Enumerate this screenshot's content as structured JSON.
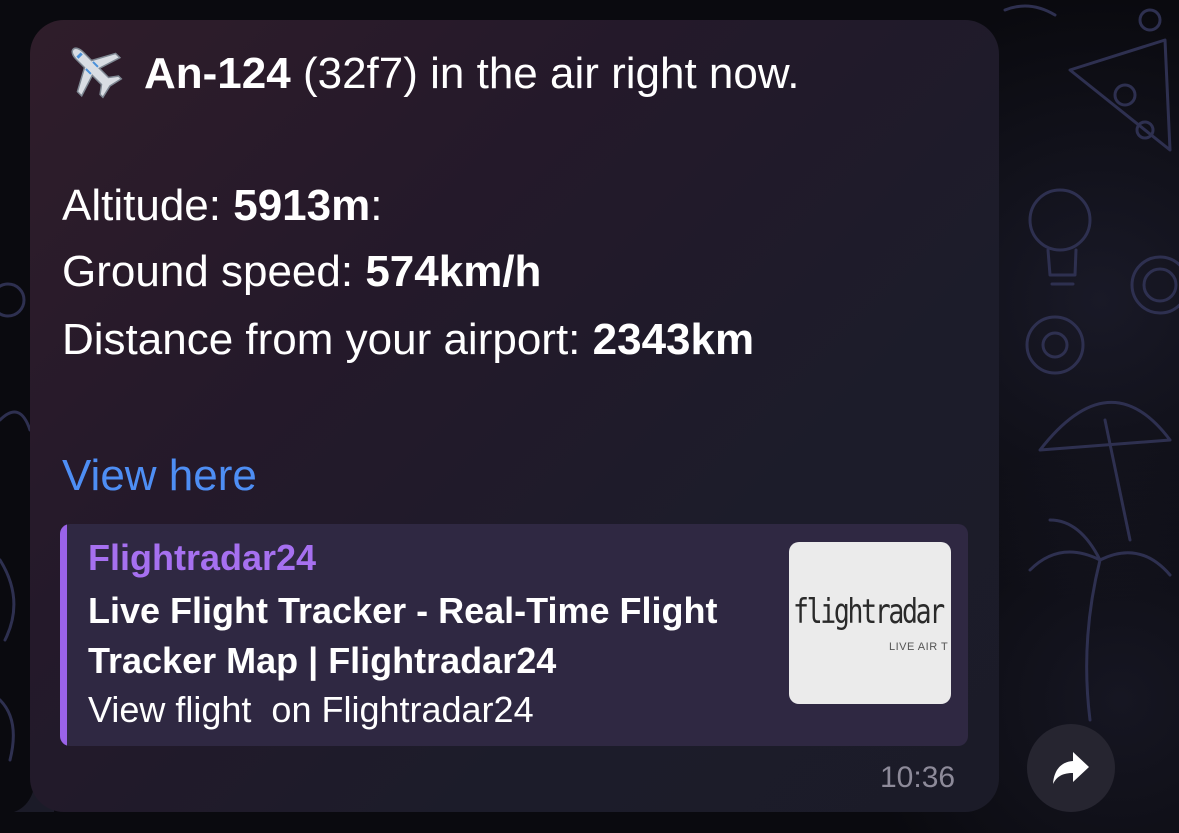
{
  "message": {
    "title_aircraft": "An-124",
    "title_code": "(32f7)",
    "title_rest": " in the air right now.",
    "altitude_label": "Altitude: ",
    "altitude_value": "5913m",
    "altitude_suffix": ":",
    "speed_label": "Ground speed: ",
    "speed_value": "574km/h",
    "distance_label": "Distance from your airport: ",
    "distance_value": "2343km",
    "link_text": "View here"
  },
  "preview": {
    "site_name": "Flightradar24",
    "title": "Live Flight Tracker - Real-Time Flight Tracker Map | Flightradar24",
    "description": "View flight  on Flightradar24",
    "thumbnail_logo": "flightradar",
    "thumbnail_tagline": "LIVE AIR T"
  },
  "timestamp": "10:36",
  "icons": {
    "title_icon": "airplane-icon",
    "share": "share-arrow-icon"
  },
  "colors": {
    "link": "#4e8ef4",
    "preview_accent": "#9a63e8",
    "timestamp": "#8d8a99"
  }
}
